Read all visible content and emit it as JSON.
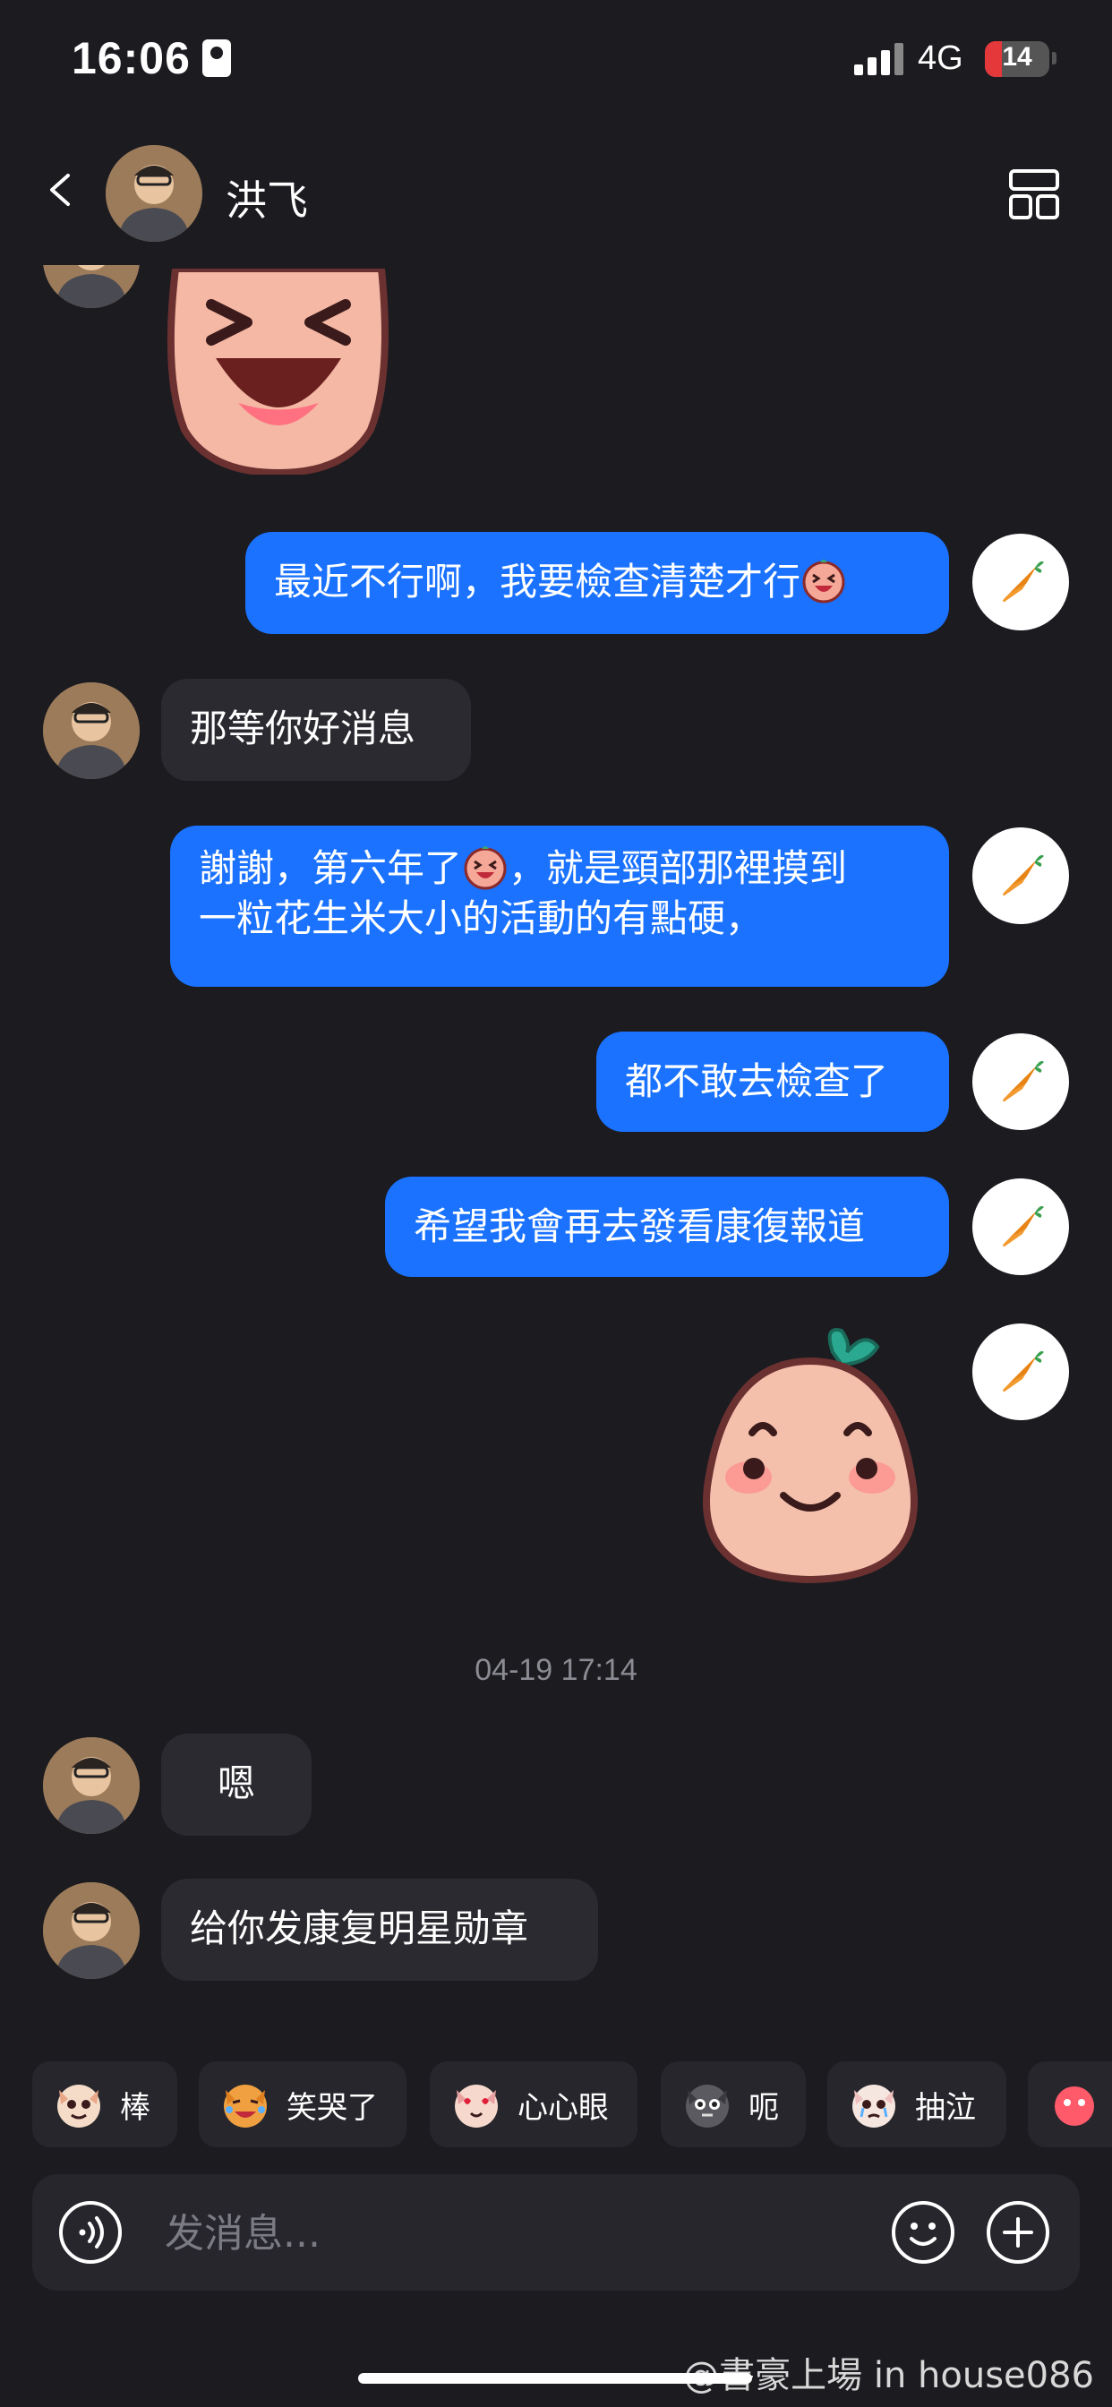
{
  "status_bar": {
    "time": "16:06",
    "network": "4G",
    "battery": "14"
  },
  "header": {
    "contact_name": "洪飞"
  },
  "messages": [
    {
      "side": "in",
      "type": "sticker"
    },
    {
      "side": "out",
      "text": "最近不行啊，我要檢查清楚才行"
    },
    {
      "side": "in",
      "text": "那等你好消息"
    },
    {
      "side": "out",
      "line1": "謝謝，第六年了",
      "line1b": "，就是頸部那裡摸到",
      "line2": "一粒花生米大小的活動的有點硬，"
    },
    {
      "side": "out",
      "text": "都不敢去檢查了"
    },
    {
      "side": "out",
      "text": "希望我會再去發看康復報道"
    },
    {
      "side": "out",
      "type": "sticker"
    },
    {
      "side": "in",
      "text": "嗯"
    },
    {
      "side": "in",
      "text": "给你发康复明星勋章"
    }
  ],
  "timestamp": "04-19 17:14",
  "quick_reactions": [
    {
      "label": "棒"
    },
    {
      "label": "笑哭了"
    },
    {
      "label": "心心眼"
    },
    {
      "label": "呃"
    },
    {
      "label": "抽泣"
    }
  ],
  "input": {
    "placeholder": "发消息..."
  },
  "watermark": "@書豪上場 in house086",
  "colors": {
    "background": "#1b1b20",
    "outgoing_bubble": "#1a72ff",
    "incoming_bubble": "#2a2a30"
  }
}
